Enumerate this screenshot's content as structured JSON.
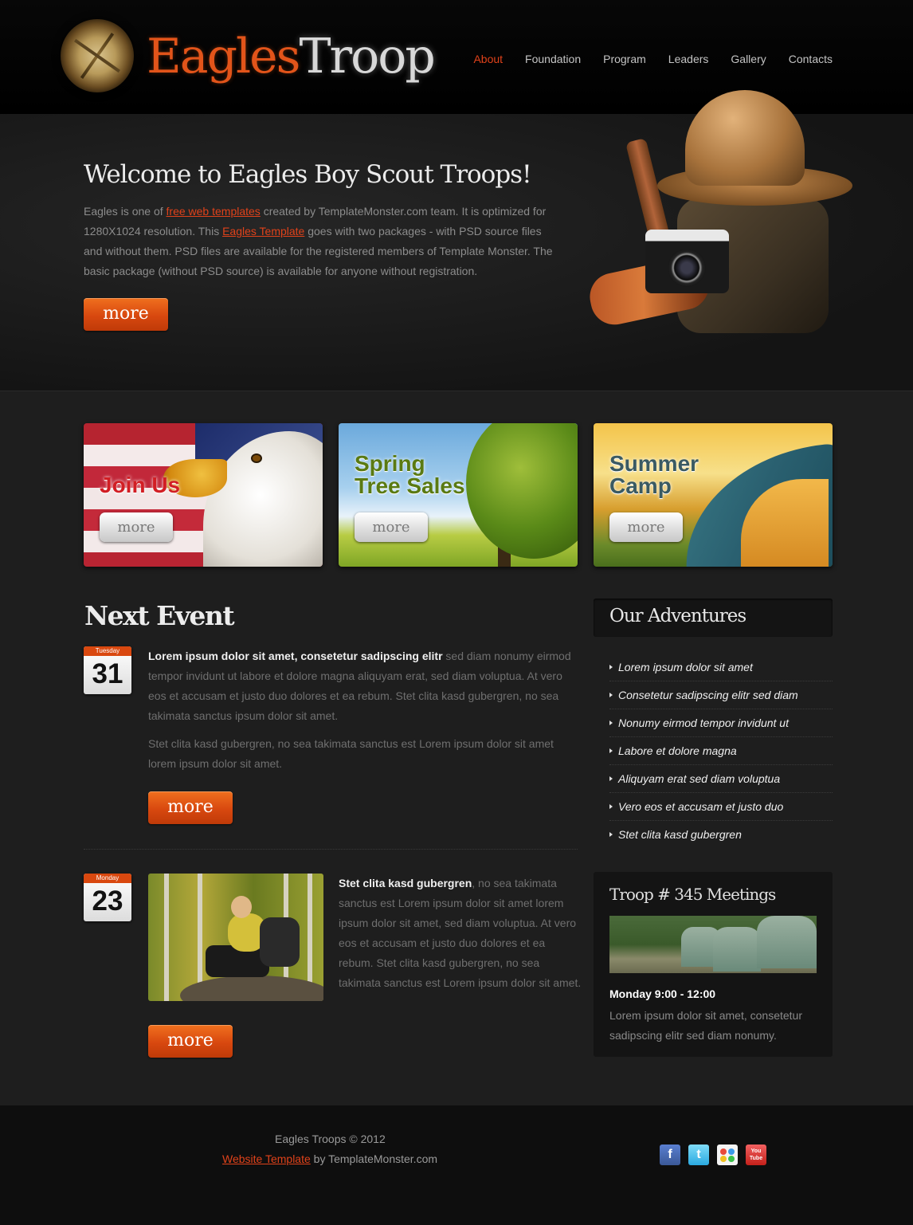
{
  "header": {
    "logo_word1": "Eagles",
    "logo_word2": "Troop",
    "nav": [
      "About",
      "Foundation",
      "Program",
      "Leaders",
      "Gallery",
      "Contacts"
    ],
    "active_nav": "About"
  },
  "hero": {
    "title": "Welcome to Eagles Boy Scout Troops!",
    "text_1": "Eagles is one of ",
    "link_1": "free web templates",
    "text_2": " created by TemplateMonster.com team. It is optimized for 1280X1024 resolution. This ",
    "link_2": "Eagles Template",
    "text_3": " goes with two packages - with PSD source files and without them. PSD files are available for the registered members of Template Monster. The basic package (without PSD source) is available for anyone without registration.",
    "more_label": "more"
  },
  "promos": [
    {
      "title_line1": "Join Us",
      "title_line2": "",
      "button": "more"
    },
    {
      "title_line1": "Spring",
      "title_line2": "Tree Sales",
      "button": "more"
    },
    {
      "title_line1": "Summer",
      "title_line2": "Camp",
      "button": "more"
    }
  ],
  "next_event": {
    "title": "Next Event",
    "events": [
      {
        "day_name": "Tuesday",
        "day_num": "31",
        "bold": "Lorem ipsum dolor sit amet, consetetur sadipscing elitr",
        "text": " sed diam nonumy eirmod tempor invidunt ut labore et dolore magna aliquyam erat, sed diam voluptua. At vero eos et accusam et justo duo dolores et ea rebum. Stet clita kasd gubergren, no sea takimata sanctus ipsum dolor sit amet.",
        "text2": "Stet clita kasd gubergren, no sea takimata sanctus est Lorem ipsum dolor sit amet lorem ipsum dolor sit amet.",
        "more": "more"
      },
      {
        "day_name": "Monday",
        "day_num": "23",
        "bold": "Stet clita kasd gubergren",
        "text": ", no sea takimata sanctus est Lorem ipsum dolor sit amet lorem ipsum dolor sit amet, sed diam voluptua. At vero eos et accusam et justo duo dolores et ea rebum. Stet clita kasd gubergren, no sea takimata sanctus est Lorem ipsum dolor sit amet.",
        "more": "more"
      }
    ]
  },
  "sidebar": {
    "adventures_title": "Our Adventures",
    "adventures": [
      "Lorem ipsum dolor sit amet",
      "Consetetur sadipscing elitr sed diam",
      "Nonumy eirmod tempor invidunt ut",
      "Labore et dolore magna",
      "Aliquyam erat sed diam voluptua",
      "Vero eos et accusam et justo duo",
      "Stet clita kasd gubergren"
    ],
    "meetings_title": "Troop # 345 Meetings",
    "meetings_time": "Monday 9:00 - 12:00",
    "meetings_text": "Lorem ipsum dolor sit amet, consetetur sadipscing elitr sed diam nonumy."
  },
  "footer": {
    "copyright": "Eagles Troops © 2012",
    "link_text": "Website Template",
    "link_suffix": " by TemplateMonster.com",
    "social": [
      "facebook-icon",
      "twitter-icon",
      "picasa-icon",
      "youtube-icon"
    ],
    "youtube_label_1": "You",
    "youtube_label_2": "Tube"
  },
  "colors": {
    "accent": "#e0421a",
    "background": "#1e1e1e",
    "header": "#000000"
  }
}
